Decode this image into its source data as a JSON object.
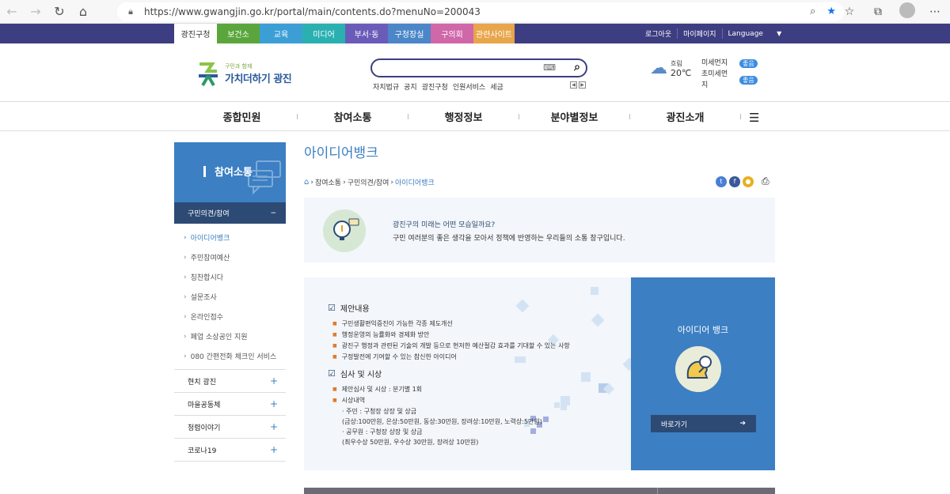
{
  "browser": {
    "url": "https://www.gwangjin.go.kr/portal/main/contents.do?menuNo=200043"
  },
  "topbar": {
    "tabs": [
      {
        "label": "광진구청",
        "color": "#ffffff",
        "text": "#333333"
      },
      {
        "label": "보건소",
        "color": "#5aa63c",
        "text": "#ffffff"
      },
      {
        "label": "교육",
        "color": "#3b9fd6",
        "text": "#ffffff"
      },
      {
        "label": "미디어",
        "color": "#2ab0b0",
        "text": "#ffffff"
      },
      {
        "label": "부서·동",
        "color": "#6a5bb8",
        "text": "#ffffff"
      },
      {
        "label": "구청장실",
        "color": "#4b86c8",
        "text": "#ffffff"
      },
      {
        "label": "구의회",
        "color": "#d067a8",
        "text": "#ffffff"
      },
      {
        "label": "관련사이트",
        "color": "#e8a54a",
        "text": "#ffffff"
      }
    ],
    "logout": "로그아웃",
    "mypage": "마이페이지",
    "language": "Language",
    "language_arrow": "▼"
  },
  "header": {
    "logo_small": "구민과 함께",
    "logo_big": "가치더하기 광진",
    "keywords": [
      "자치법규",
      "공지",
      "광진구청",
      "인원서비스",
      "세금"
    ],
    "weather_label": "흐림",
    "temperature": "20℃",
    "dust_fine": "미세먼지",
    "dust_ultra": "초미세먼지",
    "dust_fine_status": "좋음",
    "dust_ultra_status": "좋음"
  },
  "mainnav": {
    "items": [
      "종합민원",
      "참여소통",
      "행정정보",
      "분야별정보",
      "광진소개"
    ]
  },
  "sidebar": {
    "title": "참여소통",
    "open_group": "구민의견/참여",
    "open_group_toggle": "−",
    "items": [
      {
        "label": "아이디어뱅크",
        "active": true
      },
      {
        "label": "주민참여예산",
        "active": false
      },
      {
        "label": "칭찬합시다",
        "active": false
      },
      {
        "label": "설문조사",
        "active": false
      },
      {
        "label": "온라인접수",
        "active": false
      },
      {
        "label": "폐업 소상공인 지원",
        "active": false
      },
      {
        "label": "080 간편전화 체크인 서비스",
        "active": false
      }
    ],
    "groups": [
      "현치 광진",
      "마을공동체",
      "청렴이야기",
      "코로나19"
    ],
    "group_toggle": "+"
  },
  "content": {
    "title": "아이디어뱅크",
    "breadcrumb": [
      "참여소통",
      "구민의견/참여",
      "아이디어뱅크"
    ],
    "intro_question": "광진구의 미래는 어떤 모습일까요?",
    "intro_desc": "구민 여러분의 좋은 생각을 모아서 정책에 반영하는 우리들의 소통 창구입니다.",
    "sec1_title": "제안내용",
    "sec1_items": [
      "구민생활편익증진이 가능한 각종 제도개선",
      "행정운영의 능률화와 경제화 방안",
      "광진구 행정과 관련된 기술의 개발 등으로 현저한 예산절감 효과를 기대할 수 있는 사항",
      "구정발전에 기여할 수 있는 참신한 아이디어"
    ],
    "sec2_title": "심사 및 시상",
    "sec2_items": [
      "제안심사 및 시상 : 분기별 1회",
      "시상내역"
    ],
    "sec2_sub": [
      "· 주민 : 구청장 상장 및 상금",
      "(금상:100만원, 은상:50만원, 동상:30만원, 장려상:10만원, 노력상:5만원)",
      "· 공무원 : 구청장 상장 및 상금",
      "(최우수상 50만원, 우수상 30만원, 장려상 10만원)"
    ],
    "cta_title": "아이디어 뱅크",
    "cta_button": "바로가기",
    "cta_arrow": "➔"
  },
  "colors": {
    "primary": "#3c7fc3",
    "navy": "#2d4a74",
    "topbar": "#3d3d82"
  }
}
